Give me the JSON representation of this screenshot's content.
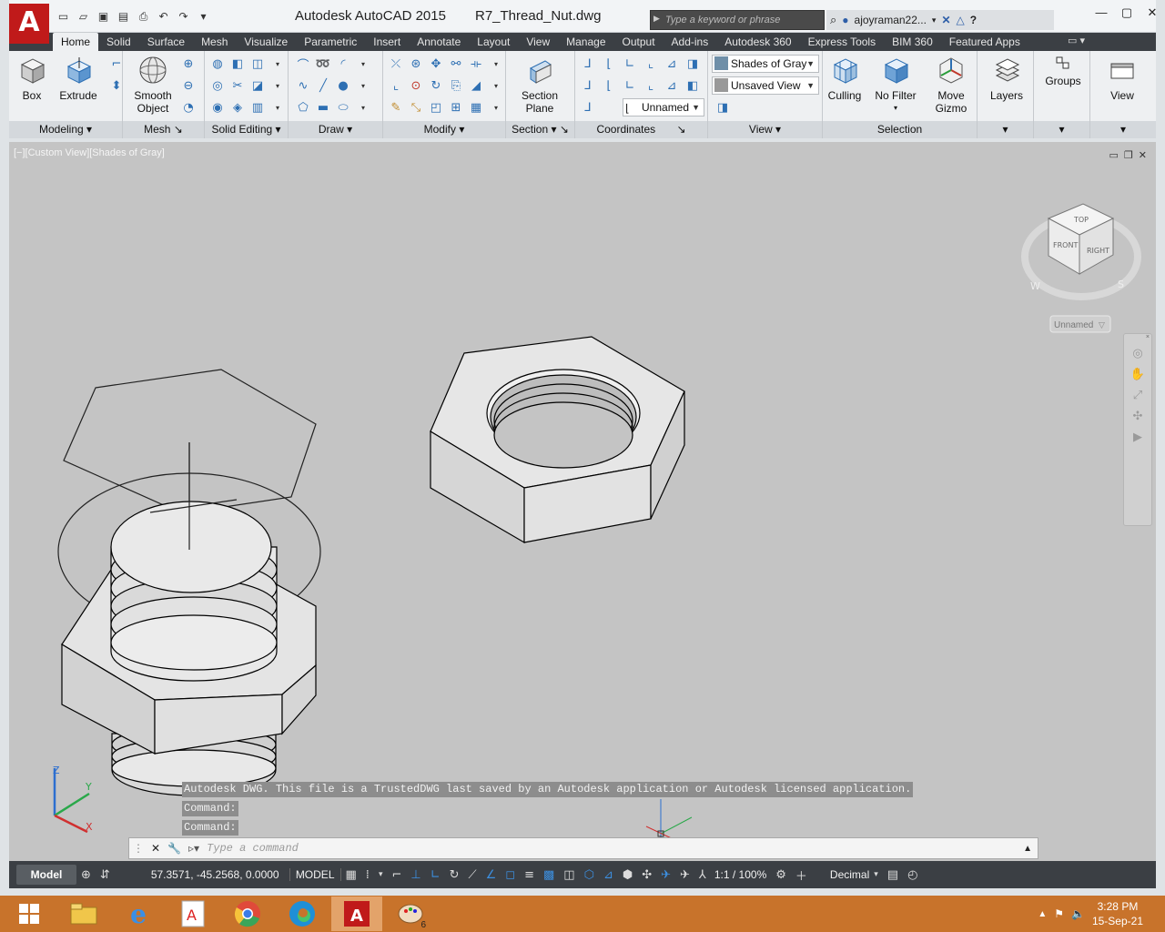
{
  "title": {
    "app": "Autodesk AutoCAD 2015",
    "file": "R7_Thread_Nut.dwg",
    "logo": "A"
  },
  "search": {
    "placeholder": "Type a keyword or phrase"
  },
  "user": {
    "name": "ajoyraman22..."
  },
  "tabs": [
    "Home",
    "Solid",
    "Surface",
    "Mesh",
    "Visualize",
    "Parametric",
    "Insert",
    "Annotate",
    "Layout",
    "View",
    "Manage",
    "Output",
    "Add-ins",
    "Autodesk 360",
    "Express Tools",
    "BIM 360",
    "Featured Apps"
  ],
  "ribbon": {
    "modeling": {
      "title": "Modeling",
      "box": "Box",
      "extrude": "Extrude"
    },
    "mesh": {
      "title": "Mesh",
      "smooth_l1": "Smooth",
      "smooth_l2": "Object"
    },
    "solid_editing": {
      "title": "Solid Editing"
    },
    "draw": {
      "title": "Draw"
    },
    "modify": {
      "title": "Modify"
    },
    "section": {
      "title": "Section",
      "plane_l1": "Section",
      "plane_l2": "Plane"
    },
    "coordinates": {
      "title": "Coordinates",
      "ucs": "Unnamed"
    },
    "view": {
      "title": "View",
      "visual_style": "Shades of Gray",
      "saved_view": "Unsaved View"
    },
    "selection": {
      "title": "Selection",
      "culling": "Culling",
      "no_filter": "No Filter",
      "gizmo_l1": "Move",
      "gizmo_l2": "Gizmo"
    },
    "layers": "Layers",
    "groups": "Groups",
    "view_btn": "View"
  },
  "viewport": {
    "label": "[−][Custom View][Shades of Gray]",
    "viewcube": {
      "top": "TOP",
      "front": "FRONT",
      "right": "RIGHT",
      "w": "W",
      "s": "S",
      "ucs_name": "Unnamed"
    }
  },
  "command": {
    "history": [
      "Autodesk DWG.  This file is a TrustedDWG last saved by an Autodesk application or Autodesk licensed application.",
      "Command:",
      "Command:"
    ],
    "placeholder": "Type a command"
  },
  "status": {
    "model_tab": "Model",
    "coords": "57.3571, -45.2568, 0.0000",
    "model": "MODEL",
    "scale": "1:1 / 100%",
    "units": "Decimal"
  },
  "taskbar": {
    "time": "3:28 PM",
    "date": "15-Sep-21",
    "badge": "6"
  }
}
